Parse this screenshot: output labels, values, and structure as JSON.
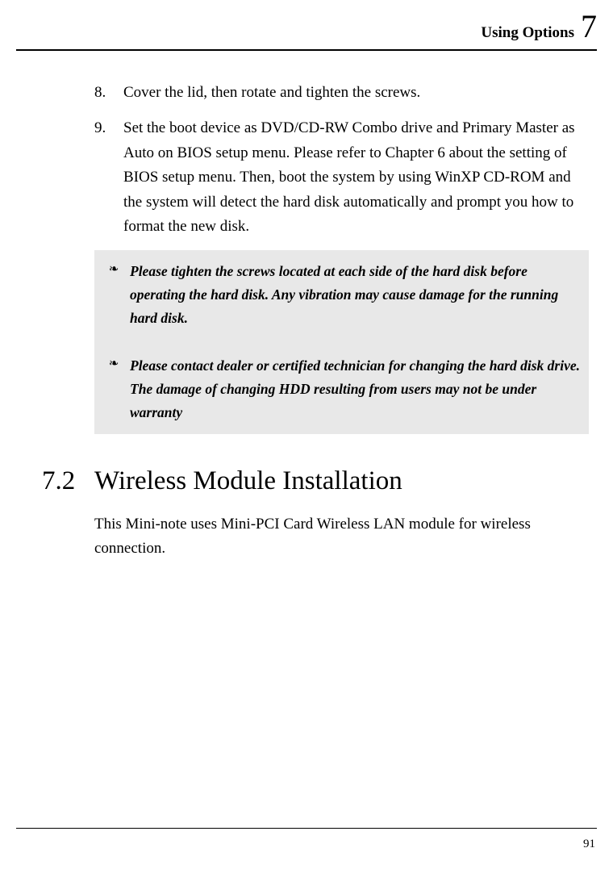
{
  "header": {
    "title": "Using Options",
    "chapter": "7"
  },
  "items": [
    {
      "num": "8.",
      "text": "Cover the lid, then rotate and tighten the screws."
    },
    {
      "num": "9.",
      "text": "Set the boot device as DVD/CD-RW Combo drive and Primary Master as Auto on BIOS setup menu. Please refer to Chapter 6 about the setting of BIOS setup menu. Then, boot the system by using WinXP CD-ROM and the system will detect the hard disk automatically and prompt you how to format the new disk."
    }
  ],
  "notes": [
    "Please tighten the screws located at each side of the hard disk before operating the hard disk. Any vibration may cause damage for the running hard disk.",
    "Please contact dealer or certified technician for changing the hard disk drive. The damage of changing HDD resulting from users may not be under warranty"
  ],
  "note_bullet": "❧",
  "section": {
    "num": "7.2",
    "title": "Wireless Module Installation",
    "body": "This Mini-note uses Mini-PCI Card Wireless LAN module for wireless connection."
  },
  "page_num": "91"
}
